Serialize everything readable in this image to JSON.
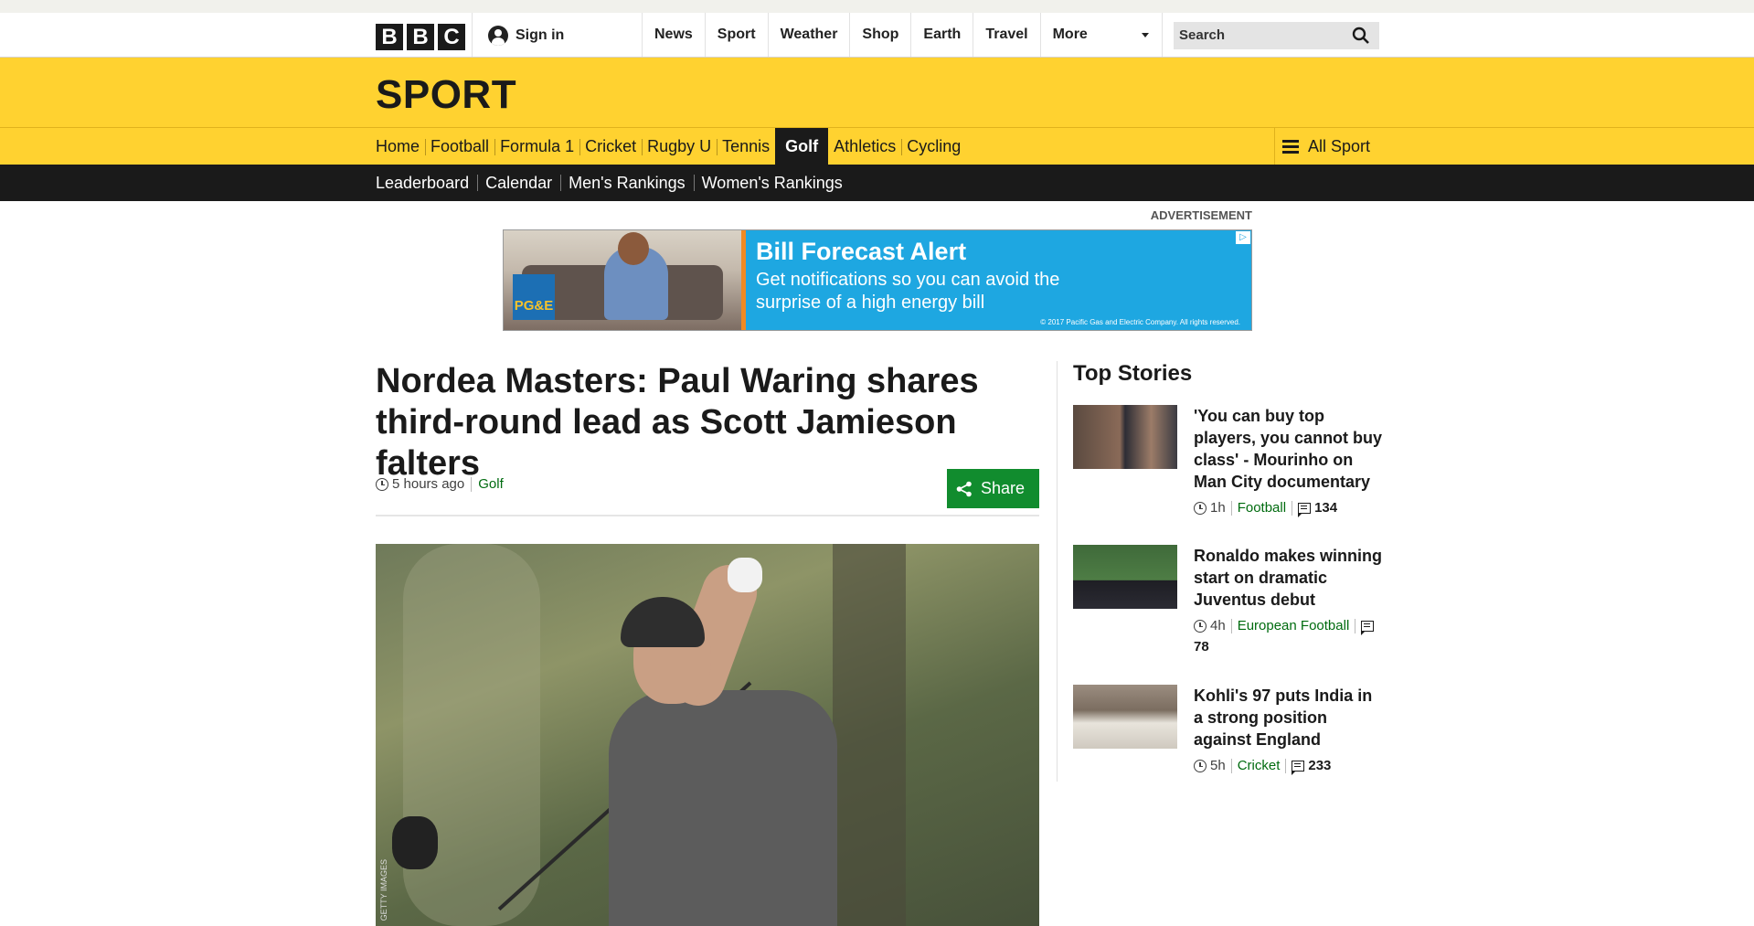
{
  "global_nav": {
    "logo_letters": [
      "B",
      "B",
      "C"
    ],
    "sign_in": "Sign in",
    "links": [
      "News",
      "Sport",
      "Weather",
      "Shop",
      "Earth",
      "Travel"
    ],
    "more": "More",
    "search_placeholder": "Search"
  },
  "sport": {
    "title": "SPORT",
    "nav": [
      "Home",
      "Football",
      "Formula 1",
      "Cricket",
      "Rugby U",
      "Tennis",
      "Golf",
      "Athletics",
      "Cycling"
    ],
    "active": "Golf",
    "all_sport": "All Sport"
  },
  "subnav": [
    "Leaderboard",
    "Calendar",
    "Men's Rankings",
    "Women's Rankings"
  ],
  "ad": {
    "label": "ADVERTISEMENT",
    "logo": "PG&E",
    "headline": "Bill Forecast Alert",
    "body": "Get notifications so you can avoid the surprise of a high energy bill",
    "fine_print": "© 2017 Pacific Gas and Electric Company. All rights reserved."
  },
  "article": {
    "headline": "Nordea Masters: Paul Waring shares third-round lead as Scott Jamieson falters",
    "time": "5 hours ago",
    "topic": "Golf",
    "share": "Share",
    "photo_credit": "GETTY IMAGES"
  },
  "top_stories": {
    "title": "Top Stories",
    "items": [
      {
        "title": "'You can buy top players, you cannot buy class' - Mourinho on Man City documentary",
        "time": "1h",
        "topic": "Football",
        "comments": "134"
      },
      {
        "title": "Ronaldo makes winning start on dramatic Juventus debut",
        "time": "4h",
        "topic": "European Football",
        "comments": "78"
      },
      {
        "title": "Kohli's 97 puts India in a strong position against England",
        "time": "5h",
        "topic": "Cricket",
        "comments": "233"
      }
    ]
  },
  "colors": {
    "sport_yellow": "#ffd230",
    "subnav_black": "#1a1a1a",
    "share_green": "#118c2e",
    "topic_green": "#006b0f",
    "ad_blue": "#1ea7e1"
  }
}
